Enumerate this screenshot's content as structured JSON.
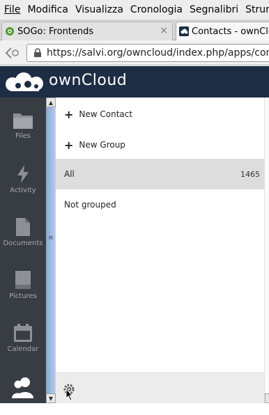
{
  "menubar": {
    "items": [
      "File",
      "Modifica",
      "Visualizza",
      "Cronologia",
      "Segnalibri",
      "Strumenti"
    ]
  },
  "tabs": [
    {
      "title": "SOGo: Frontends",
      "icon": "sogo-icon",
      "close": "×"
    },
    {
      "title": "Contacts - ownCloud",
      "icon": "owncloud-icon"
    }
  ],
  "navbar": {
    "url": "https://salvi.org/owncloud/index.php/apps/contacts/"
  },
  "header": {
    "brand_prefix": "",
    "brand_word": "ownCloud"
  },
  "appnav": {
    "items": [
      {
        "label": "Files",
        "icon": "folder-icon"
      },
      {
        "label": "Activity",
        "icon": "lightning-icon"
      },
      {
        "label": "Documents",
        "icon": "document-icon"
      },
      {
        "label": "Pictures",
        "icon": "picture-icon"
      },
      {
        "label": "Calendar",
        "icon": "calendar-icon"
      },
      {
        "label": "",
        "icon": "contacts-icon"
      }
    ]
  },
  "panel": {
    "new_contact": "New Contact",
    "new_group": "New Group",
    "groups": [
      {
        "name": "All",
        "count": "1465"
      },
      {
        "name": "Not grouped",
        "count": ""
      }
    ]
  },
  "colors": {
    "header_bg": "#1d2d44",
    "nav_bg": "#383c43",
    "selected_row": "#dddddd"
  }
}
